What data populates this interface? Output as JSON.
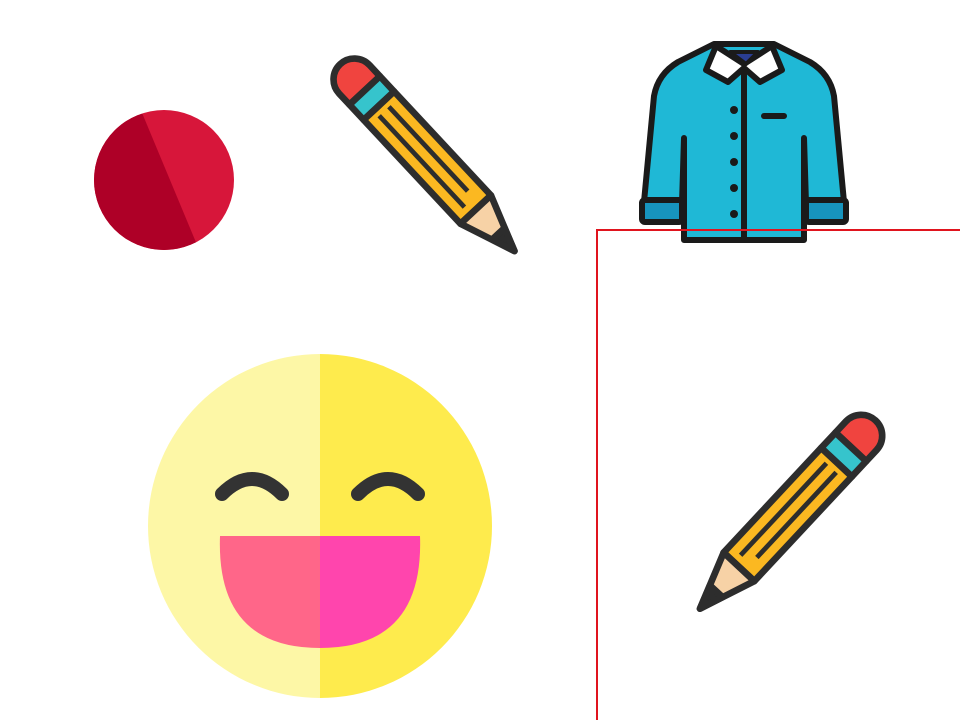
{
  "canvas": {
    "background": "#ffffff"
  },
  "objects": [
    {
      "name": "red-circle-icon",
      "colors": [
        "#d7163a",
        "#ae0027"
      ]
    },
    {
      "name": "pencil-icon",
      "colors": [
        "#f0443f",
        "#36c4cc",
        "#fbb821",
        "#f7d2a6",
        "#2d2d2d"
      ]
    },
    {
      "name": "shirt-icon",
      "colors": [
        "#1fb8d6",
        "#1794be",
        "#ffffff",
        "#2a3e93"
      ]
    },
    {
      "name": "laughing-face-icon",
      "colors": [
        "#fdf7a6",
        "#feeb4d",
        "#ff6689",
        "#ff45ad",
        "#333333"
      ]
    },
    {
      "name": "pencil-icon",
      "colors": [
        "#f0443f",
        "#36c4cc",
        "#fbb821",
        "#f7d2a6",
        "#2d2d2d"
      ]
    }
  ],
  "selection": {
    "color": "#e0141e"
  }
}
